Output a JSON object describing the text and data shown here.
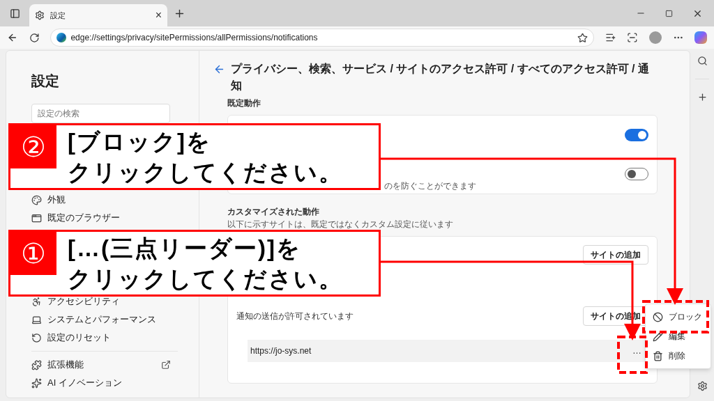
{
  "browser": {
    "tab": {
      "title": "設定",
      "close": "×"
    },
    "address": "edge://settings/privacy/sitePermissions/allPermissions/notifications"
  },
  "sidebar": {
    "title": "設定",
    "search": {
      "placeholder": "設定の検索"
    },
    "items_upper": [
      {
        "label": "外観"
      },
      {
        "label": "既定のブラウザー"
      }
    ],
    "items_lower": [
      {
        "label": "アクセシビリティ"
      },
      {
        "label": "システムとパフォーマンス"
      },
      {
        "label": "設定のリセット"
      }
    ],
    "items_extra": [
      {
        "label": "拡張機能",
        "external": true
      },
      {
        "label": "AI イノベーション",
        "external": false
      }
    ]
  },
  "page": {
    "title": "プライバシー、検索、サービス / サイトのアクセス許可 / すべてのアクセス許可 / 通知",
    "default_behavior": {
      "heading": "既定動作",
      "toggles": [
        {
          "on": true
        },
        {
          "on": false,
          "description": "のを防ぐことができます"
        }
      ]
    },
    "custom": {
      "heading": "カスタマイズされた動作",
      "description": "以下に示すサイトは、既定ではなくカスタム設定に従います",
      "sections": [
        {
          "add_button": "サイトの追加"
        },
        {
          "title": "通知の送信が許可されています",
          "add_button": "サイトの追加",
          "sites": [
            {
              "url": "https://jo-sys.net",
              "more": "…"
            }
          ]
        }
      ]
    }
  },
  "context_menu": {
    "items": [
      {
        "label": "ブロック",
        "kind": "block"
      },
      {
        "label": "編集",
        "kind": "edit"
      },
      {
        "label": "削除",
        "kind": "delete"
      }
    ]
  },
  "annotations": [
    {
      "number": "②",
      "lines": [
        "[ブロック]を",
        "クリックしてください。"
      ]
    },
    {
      "number": "①",
      "lines": [
        "[…(三点リーダー)]を",
        "クリックしてください。"
      ]
    }
  ]
}
